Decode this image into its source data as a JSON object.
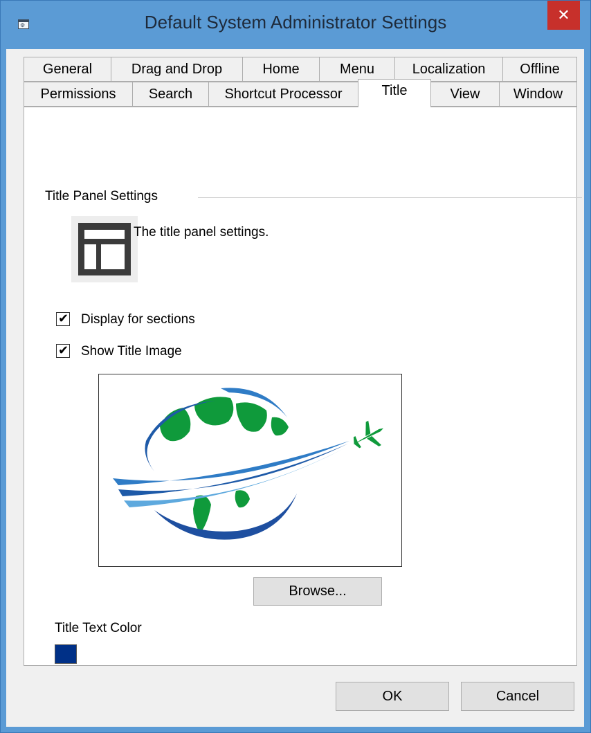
{
  "window": {
    "title": "Default System Administrator Settings",
    "close_glyph": "✕",
    "system_icon": "settings-window-icon"
  },
  "tabs": {
    "row1": [
      "General",
      "Drag and Drop",
      "Home",
      "Menu",
      "Localization",
      "Offline"
    ],
    "row2": [
      "Permissions",
      "Search",
      "Shortcut Processor",
      "Title",
      "View",
      "Window"
    ],
    "selected": "Title"
  },
  "panel": {
    "group_title": "Title Panel Settings",
    "description": "The title panel settings.",
    "icon": "title-panel-layout-icon",
    "display_for_sections": {
      "label": "Display for sections",
      "checked": true
    },
    "show_title_image": {
      "label": "Show Title Image",
      "checked": true
    },
    "title_image": "globe-airplane-logo",
    "browse_label": "Browse...",
    "title_text_color_label": "Title Text Color",
    "title_text_color": "#003087"
  },
  "footer": {
    "ok_label": "OK",
    "cancel_label": "Cancel"
  },
  "colors": {
    "frame": "#5b9bd5",
    "close": "#c7302b",
    "logo_blue": "#1e5aa8",
    "logo_green": "#0f9a3b"
  }
}
